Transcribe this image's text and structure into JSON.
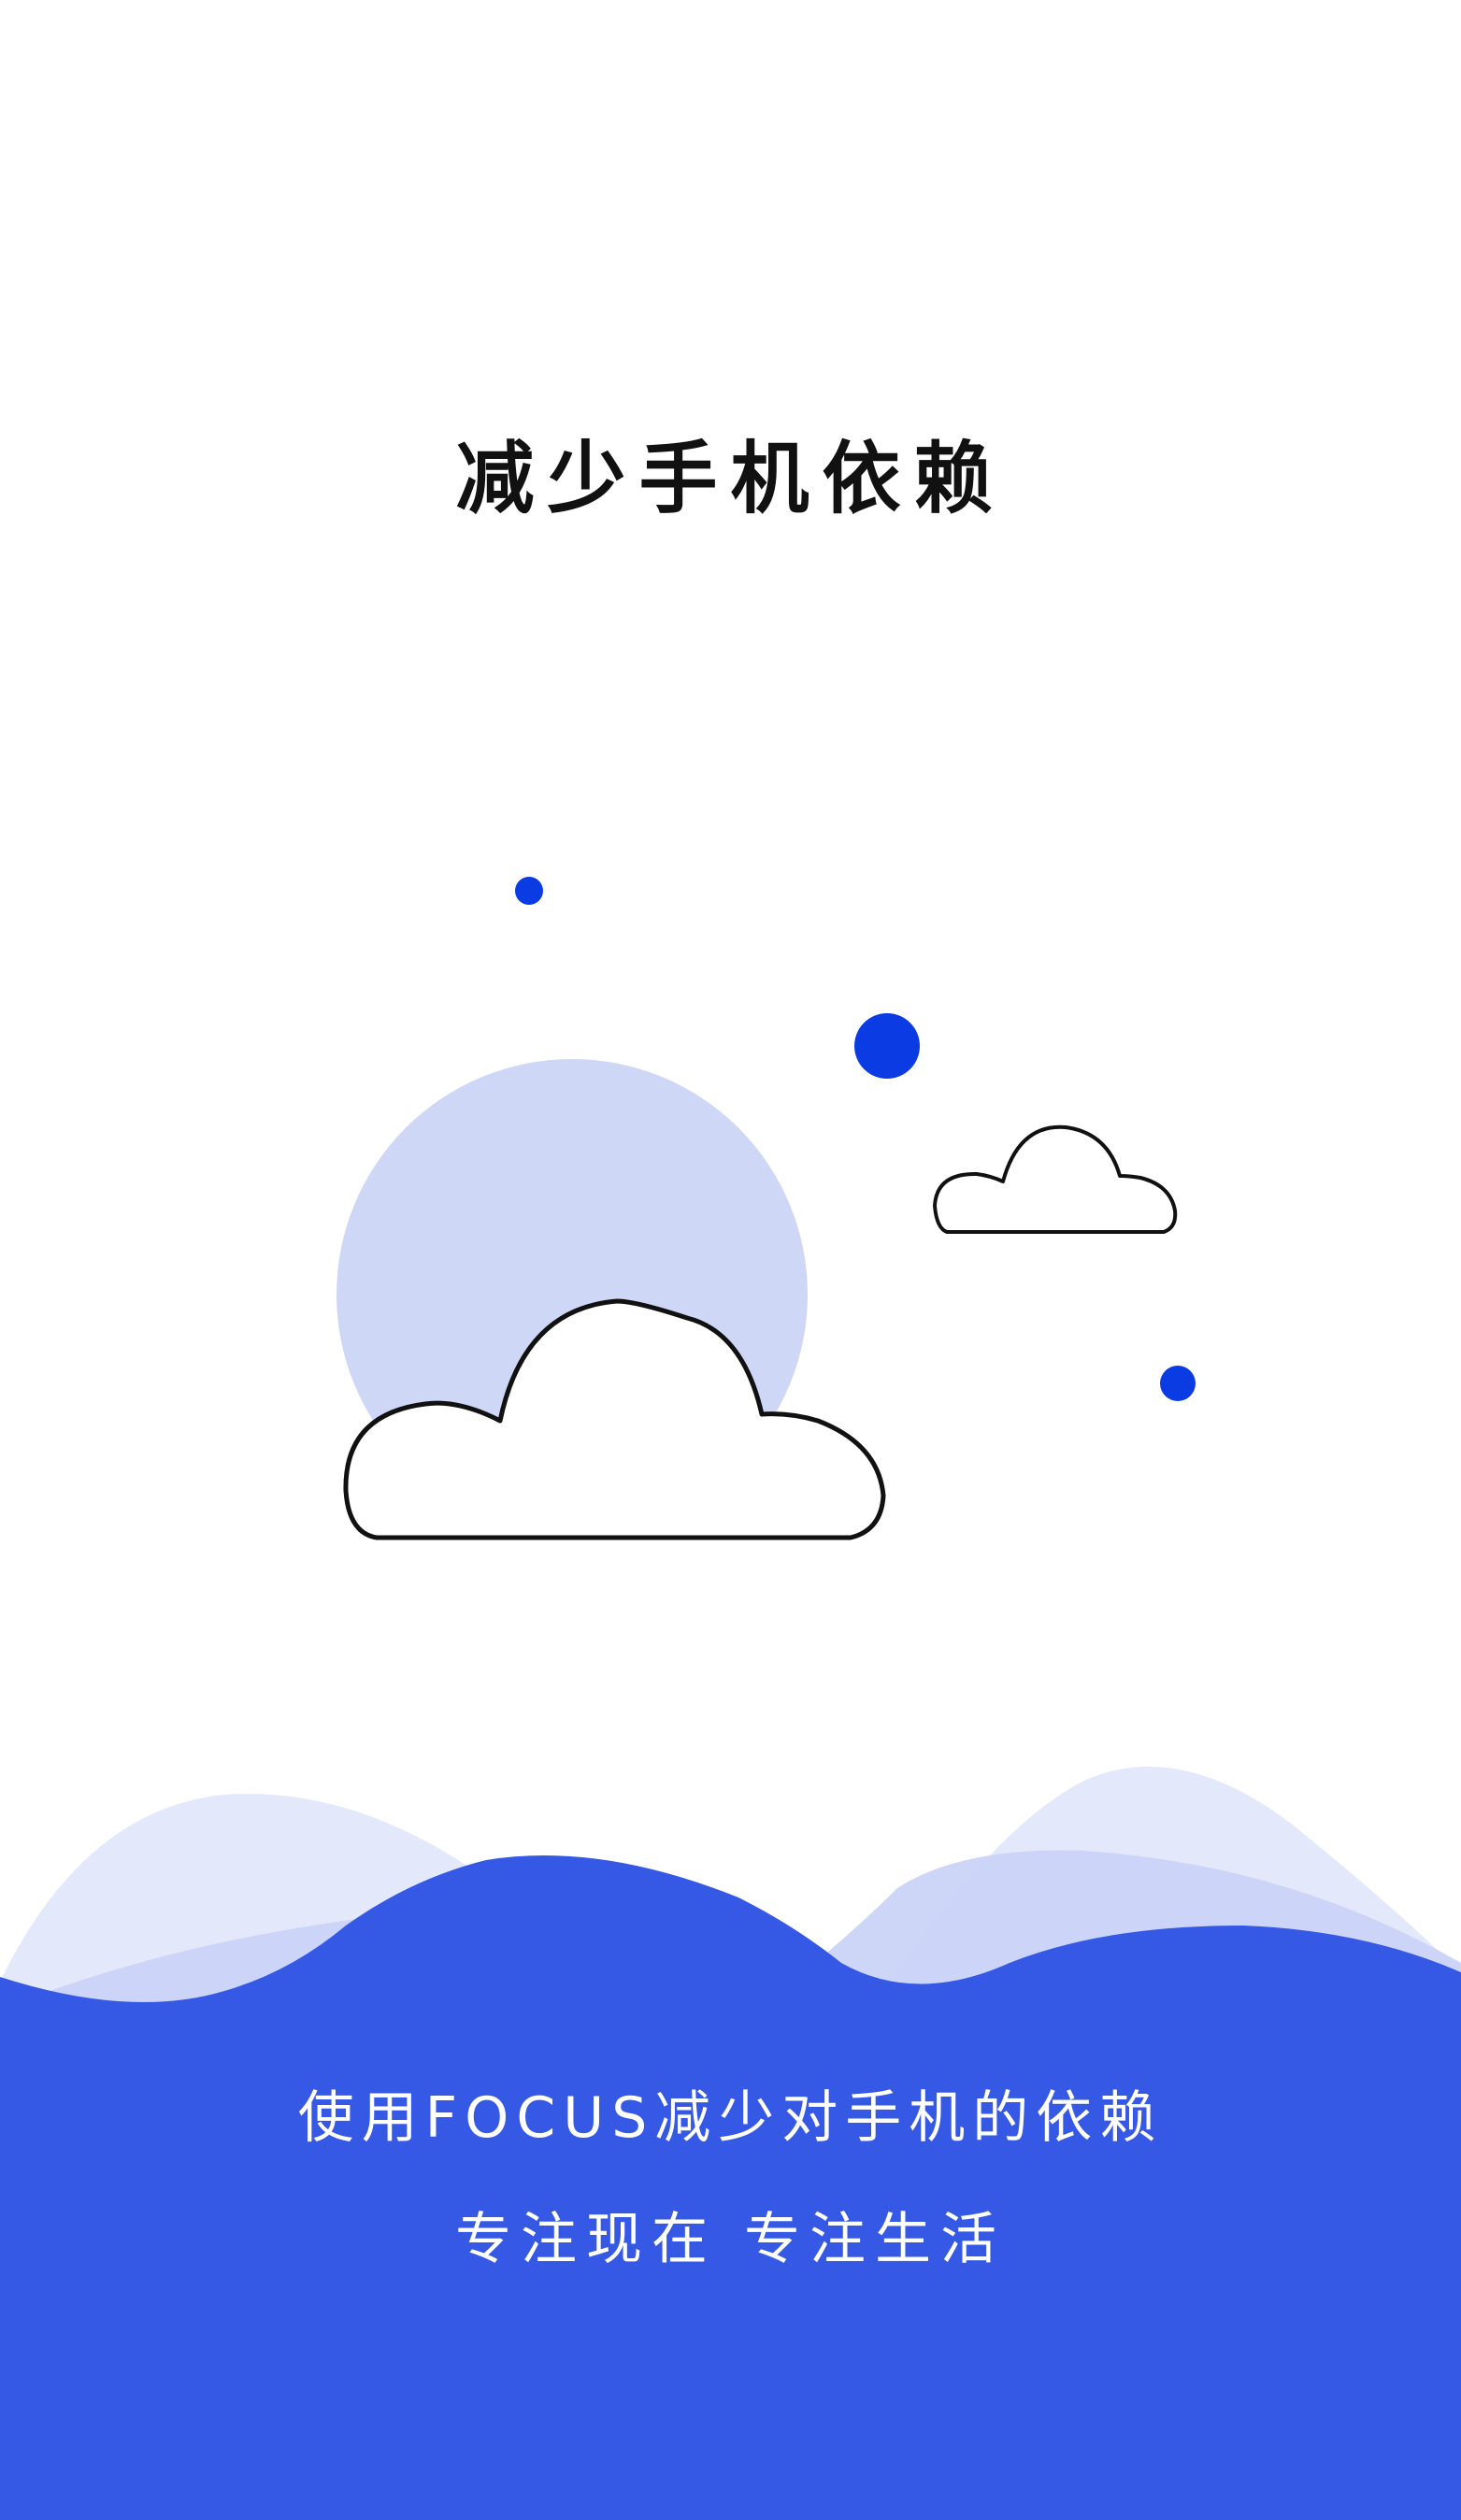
{
  "title": "减少手机依赖",
  "caption": {
    "line1": "使用FOCUS减少对手机的依赖",
    "line2": "专注现在 专注生活"
  },
  "colors": {
    "brand_blue": "#3558E5",
    "dot_blue": "#0B3BE3",
    "moon_light": "#CFD7F7",
    "wave_light": "#E3E8FB",
    "wave_mid": "#C9D2F6",
    "background": "#FFFFFF",
    "title_text": "#111111",
    "caption_text": "#FFFFFF"
  },
  "icons": {
    "large_cloud": "cloud-outline-icon",
    "small_cloud": "cloud-outline-icon",
    "moon": "moon-circle-icon",
    "dots": "dot-icon"
  }
}
